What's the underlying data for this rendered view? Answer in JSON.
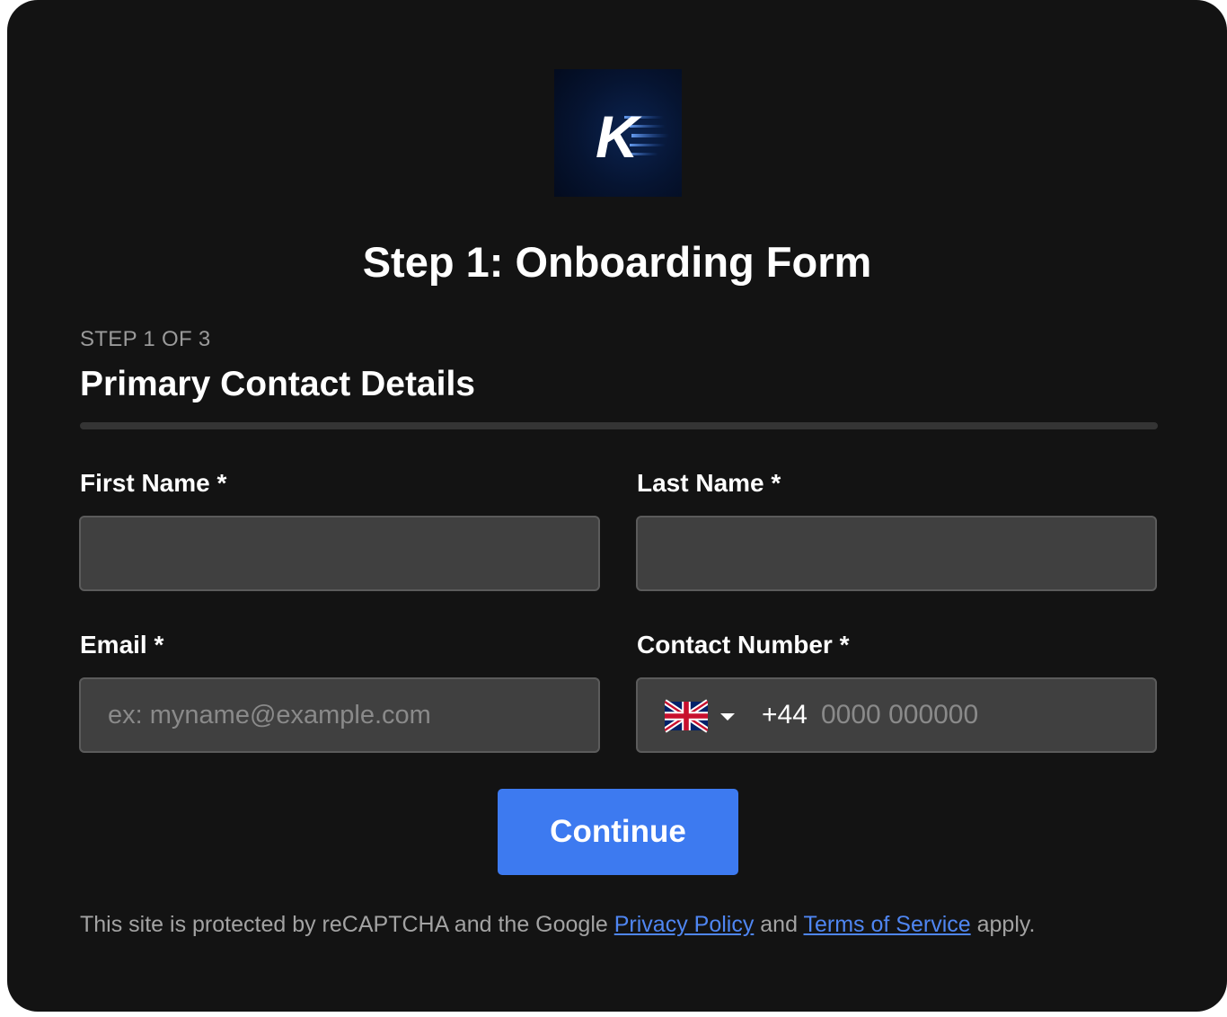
{
  "logo": {
    "letter": "K",
    "background_color": "#061431"
  },
  "page": {
    "title": "Step 1: Onboarding Form"
  },
  "step": {
    "label": "STEP 1 OF 3",
    "section_title": "Primary Contact Details",
    "progress_fraction": 0
  },
  "form": {
    "first_name": {
      "label": "First Name *",
      "value": "",
      "placeholder": ""
    },
    "last_name": {
      "label": "Last Name *",
      "value": "",
      "placeholder": ""
    },
    "email": {
      "label": "Email *",
      "value": "",
      "placeholder": "ex: myname@example.com"
    },
    "contact_number": {
      "label": "Contact Number *",
      "country_icon": "uk-flag-icon",
      "dial_code": "+44",
      "value": "",
      "placeholder": "0000 000000"
    }
  },
  "continue_button": {
    "label": "Continue",
    "color": "#3d7af0"
  },
  "footer": {
    "prefix": "This site is protected by reCAPTCHA and the Google",
    "privacy_link": "Privacy Policy",
    "middle": "and",
    "terms_link": "Terms of Service",
    "suffix": "apply."
  }
}
